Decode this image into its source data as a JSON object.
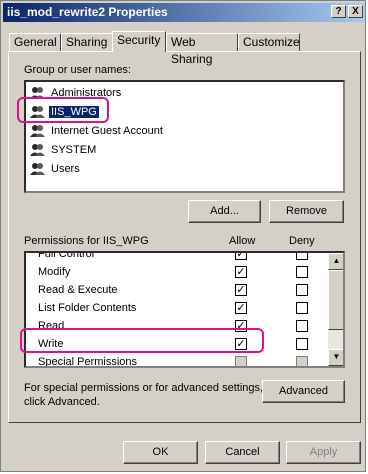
{
  "window": {
    "title": "iis_mod_rewrite2 Properties"
  },
  "title_buttons": {
    "help": "?",
    "close": "X"
  },
  "tabs": [
    "General",
    "Sharing",
    "Security",
    "Web Sharing",
    "Customize"
  ],
  "group_label": "Group or user names:",
  "users": [
    {
      "name": "Administrators"
    },
    {
      "name": "IIS_WPG"
    },
    {
      "name": "Internet Guest Account"
    },
    {
      "name": "SYSTEM"
    },
    {
      "name": "Users"
    }
  ],
  "buttons": {
    "add": "Add...",
    "remove": "Remove",
    "advanced": "Advanced",
    "ok": "OK",
    "cancel": "Cancel",
    "apply": "Apply"
  },
  "permissions": {
    "header": "Permissions for IIS_WPG",
    "allow": "Allow",
    "deny": "Deny",
    "rows": [
      {
        "name": "Full Control",
        "allow": true,
        "deny": false
      },
      {
        "name": "Modify",
        "allow": true,
        "deny": false
      },
      {
        "name": "Read & Execute",
        "allow": true,
        "deny": false
      },
      {
        "name": "List Folder Contents",
        "allow": true,
        "deny": false
      },
      {
        "name": "Read",
        "allow": true,
        "deny": false
      },
      {
        "name": "Write",
        "allow": true,
        "deny": false
      },
      {
        "name": "Special Permissions",
        "allow": false,
        "deny": false
      }
    ]
  },
  "advanced_text": "For special permissions or for advanced settings, click Advanced.",
  "colors": {
    "titlebar": "#0a246a",
    "highlight": "#e0108a",
    "face": "#d4d0c8"
  },
  "icons": {
    "user": "user-group-icon",
    "up": "scroll-up-icon",
    "down": "scroll-down-icon"
  }
}
